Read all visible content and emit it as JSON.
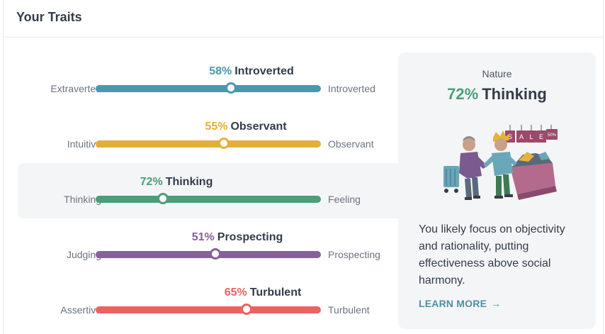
{
  "header": {
    "title": "Your Traits"
  },
  "traits": [
    {
      "percent": "58%",
      "name": "Introverted",
      "left": "Extraverted",
      "right": "Introverted",
      "value": 0.6,
      "color": "#4a98ae"
    },
    {
      "percent": "55%",
      "name": "Observant",
      "left": "Intuitive",
      "right": "Observant",
      "value": 0.57,
      "color": "#e4ae3a"
    },
    {
      "percent": "72%",
      "name": "Thinking",
      "left": "Thinking",
      "right": "Feeling",
      "value": 0.3,
      "color": "#4a9e79",
      "active": true
    },
    {
      "percent": "51%",
      "name": "Prospecting",
      "left": "Judging",
      "right": "Prospecting",
      "value": 0.53,
      "color": "#86619a"
    },
    {
      "percent": "65%",
      "name": "Turbulent",
      "left": "Assertive",
      "right": "Turbulent",
      "value": 0.67,
      "color": "#ec6262"
    }
  ],
  "panel": {
    "category": "Nature",
    "percent": "72%",
    "trait": "Thinking",
    "description": "You likely focus on objectivity and rationality, putting effectiveness above social harmony.",
    "learn_more": "LEARN MORE",
    "illustration_sign": [
      "S",
      "A",
      "L",
      "E",
      "50%"
    ]
  }
}
